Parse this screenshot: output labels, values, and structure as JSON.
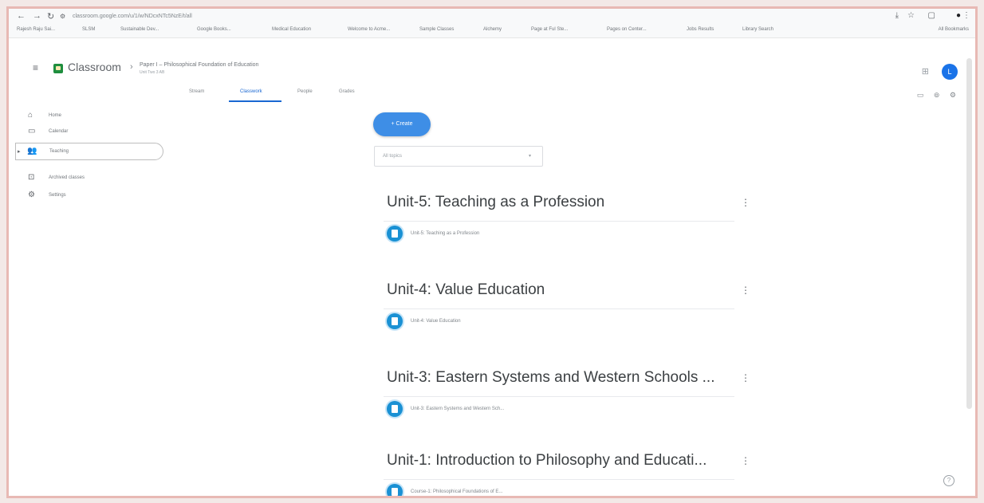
{
  "browser": {
    "url": "classroom.google.com/u/1/w/NDcxNTc5NzE/t/all",
    "bookmarks": [
      "Rajesh Raju Sai...",
      "SLSM",
      "Sustainable Dev...",
      "Google Books...",
      "Medical Education",
      "Welcome to Acme...",
      "Sample Classes",
      "Alchemy",
      "Page at Ful Ste...",
      "Pages on Center...",
      "Jobs Results",
      "Library Search"
    ],
    "all_bookmarks": "All Bookmarks"
  },
  "header": {
    "app_name": "Classroom",
    "class_title": "Paper I – Philosophical Foundation of Education",
    "class_subtitle": "Unit Two 3 AB",
    "avatar_initial": "L"
  },
  "tabs": [
    {
      "label": "Stream"
    },
    {
      "label": "Classwork"
    },
    {
      "label": "People"
    },
    {
      "label": "Grades"
    }
  ],
  "sidebar": {
    "items": [
      {
        "label": "Home",
        "icon": "home-icon"
      },
      {
        "label": "Calendar",
        "icon": "calendar-icon"
      },
      {
        "label": "Teaching",
        "icon": "people-icon"
      },
      {
        "label": "Archived classes",
        "icon": "archive-icon"
      },
      {
        "label": "Settings",
        "icon": "gear-icon"
      }
    ]
  },
  "main": {
    "create_label": "+ Create",
    "topic_filter": "All topics",
    "units": [
      {
        "title": "Unit-5: Teaching as a Profession",
        "material": "Unit-5: Teaching as a Profession"
      },
      {
        "title": "Unit-4: Value Education",
        "material": "Unit-4: Value Education"
      },
      {
        "title": "Unit-3: Eastern Systems and Western Schools ...",
        "material": "Unit-3: Eastern Systems and Western Sch..."
      },
      {
        "title": "Unit-1: Introduction to Philosophy and Educati...",
        "material": "Course-1: Philosophical Foundations of E..."
      }
    ]
  },
  "colors": {
    "accent": "#1967d2",
    "create_button": "#3e8ee6",
    "material_icon": "#1a91d4",
    "logo": "#1e8e3e"
  }
}
